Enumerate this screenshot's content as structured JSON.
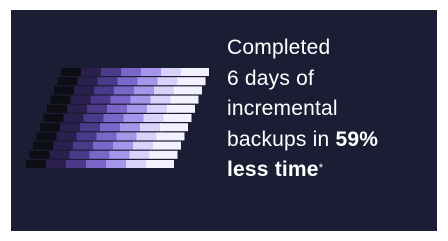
{
  "caption": {
    "line1": "Completed",
    "line2": "6 days of",
    "line3": "incremental",
    "line4_prefix": "backups in ",
    "line4_emphasis": "59%",
    "line5_emphasis": "less time",
    "footnote_mark": "*"
  },
  "colors": {
    "card_background": "#1a1d33",
    "text": "#ffffff",
    "bar_palette": [
      "#0d0d14",
      "#2a1f4d",
      "#4b3a8a",
      "#7a66c8",
      "#a596ec",
      "#d9d2fb",
      "#f4f1ff"
    ]
  },
  "graphic": {
    "icon": "speed-lines-graphic"
  }
}
